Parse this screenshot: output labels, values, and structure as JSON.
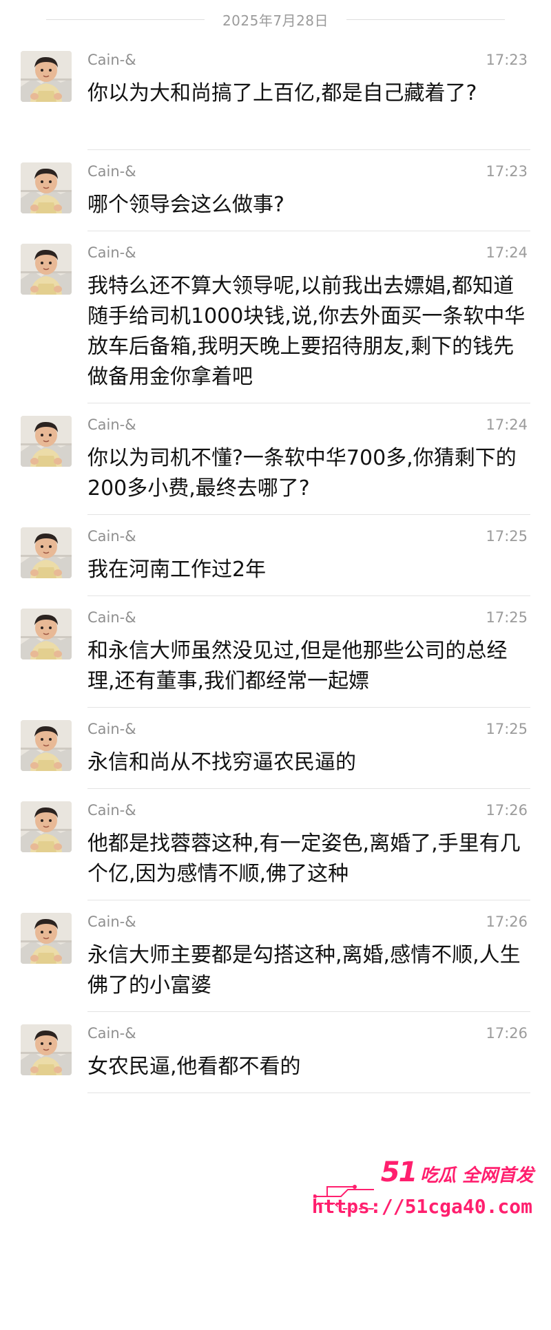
{
  "date_separator": "2025年7月28日",
  "messages": [
    {
      "sender": "Cain-&",
      "time": "17:23",
      "text": "你以为大和尚搞了上百亿,都是自己藏着了?",
      "lines": 2
    },
    {
      "sender": "Cain-&",
      "time": "17:23",
      "text": "哪个领导会这么做事?",
      "lines": 1
    },
    {
      "sender": "Cain-&",
      "time": "17:24",
      "text": "我特么还不算大领导呢,以前我出去嫖娼,都知道随手给司机1000块钱,说,你去外面买一条软中华放车后备箱,我明天晚上要招待朋友,剩下的钱先做备用金你拿着吧",
      "lines": 4
    },
    {
      "sender": "Cain-&",
      "time": "17:24",
      "text": "你以为司机不懂?一条软中华700多,你猜剩下的200多小费,最终去哪了?",
      "lines": 2
    },
    {
      "sender": "Cain-&",
      "time": "17:25",
      "text": "我在河南工作过2年",
      "lines": 1
    },
    {
      "sender": "Cain-&",
      "time": "17:25",
      "text": "和永信大师虽然没见过,但是他那些公司的总经理,还有董事,我们都经常一起嫖",
      "lines": 2
    },
    {
      "sender": "Cain-&",
      "time": "17:25",
      "text": "永信和尚从不找穷逼农民逼的",
      "lines": 1
    },
    {
      "sender": "Cain-&",
      "time": "17:26",
      "text": "他都是找蓉蓉这种,有一定姿色,离婚了,手里有几个亿,因为感情不顺,佛了这种",
      "lines": 2
    },
    {
      "sender": "Cain-&",
      "time": "17:26",
      "text": "永信大师主要都是勾搭这种,离婚,感情不顺,人生佛了的小富婆",
      "lines": 2
    },
    {
      "sender": "Cain-&",
      "time": "17:26",
      "text": "女农民逼,他看都不看的",
      "lines": 1
    }
  ],
  "watermark": {
    "brand_number": "51",
    "brand_text": "吃瓜 全网首发",
    "url": "https://51cga40.com"
  },
  "colors": {
    "watermark": "#ff1f6e",
    "divider": "#e3e3e3",
    "meta_text": "#9b9b9b"
  }
}
